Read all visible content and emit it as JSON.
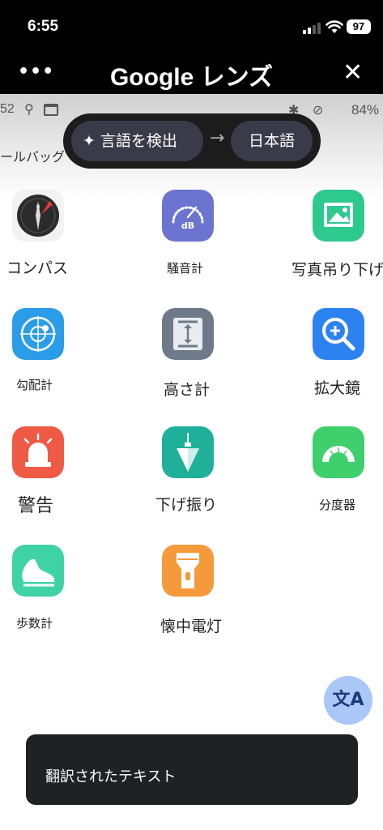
{
  "status_bar": {
    "time": "6:55",
    "battery": "97"
  },
  "lens_header": {
    "more": "•••",
    "title": "Google レンズ",
    "close": "✕"
  },
  "captured_screen": {
    "status_left": "52",
    "status_right": "✱ ⊘",
    "battery_pct": "84%",
    "folder_label": "ールバッグ"
  },
  "translate_pill": {
    "mode_label": "言語を検出",
    "arrow": "→",
    "target_language": "日本語"
  },
  "apps": [
    {
      "label": "コンパス",
      "icon": "compass-icon",
      "color": "#f2f2f2"
    },
    {
      "label": "騒音計",
      "icon": "decibel-meter-icon",
      "color": "#6b74cf"
    },
    {
      "label": "写真吊り下げ",
      "icon": "picture-hanging-icon",
      "color": "#2ec98f"
    },
    {
      "label": "勾配計",
      "icon": "level-icon",
      "color": "#2b9de8"
    },
    {
      "label": "高さ計",
      "icon": "height-meter-icon",
      "color": "#6e7a8a"
    },
    {
      "label": "拡大鏡",
      "icon": "magnifier-icon",
      "color": "#2d82f2"
    },
    {
      "label": "警告",
      "icon": "alert-light-icon",
      "color": "#ee5a43"
    },
    {
      "label": "下げ振り",
      "icon": "plumb-bob-icon",
      "color": "#1fb09a"
    },
    {
      "label": "分度器",
      "icon": "protractor-icon",
      "color": "#3fcf6d"
    },
    {
      "label": "歩数計",
      "icon": "pedometer-icon",
      "color": "#3fd3a3"
    },
    {
      "label": "懐中電灯",
      "icon": "flashlight-icon",
      "color": "#f59a3a"
    }
  ],
  "fab": {
    "label": "文A"
  },
  "snackbar": {
    "text": "翻訳されたテキスト"
  }
}
